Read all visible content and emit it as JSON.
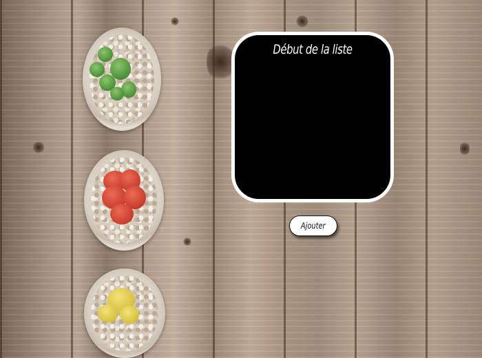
{
  "list_panel": {
    "title": "Début de la liste"
  },
  "actions": {
    "add_label": "Ajouter"
  },
  "colors": {
    "panel_bg": "#000000",
    "panel_border": "#ffffff",
    "button_bg": "#ffffff"
  },
  "decor": {
    "background": "wooden-planks",
    "plants": [
      "green-cactus-pot",
      "red-cactus-pot",
      "yellow-cactus-pot"
    ]
  }
}
